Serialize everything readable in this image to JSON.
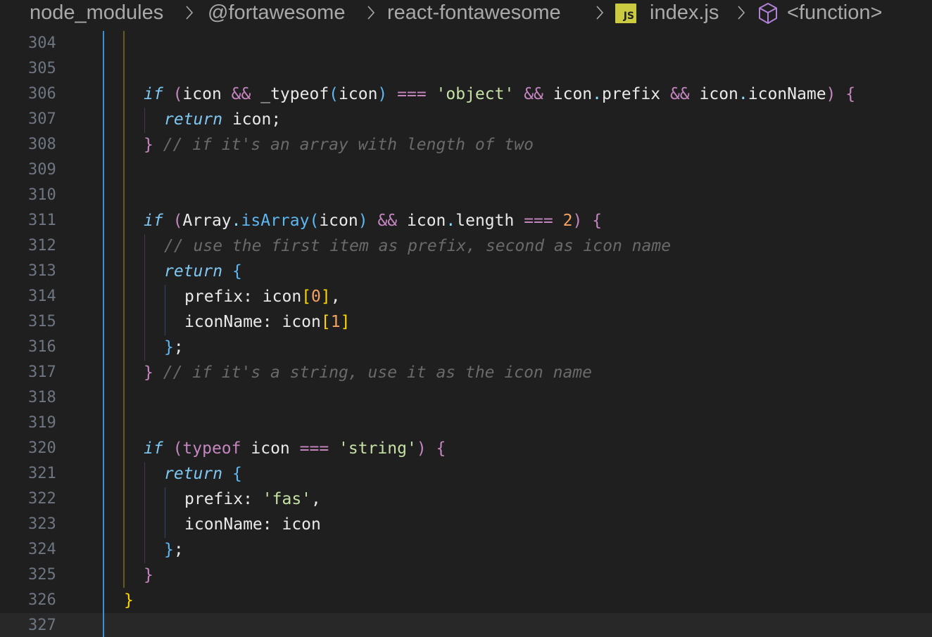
{
  "breadcrumb": {
    "segments": [
      "node_modules",
      "@fortawesome",
      "react-fontawesome",
      "index.js",
      "<function>"
    ],
    "file_badge": "JS",
    "file_icon": "javascript-file-icon",
    "symbol_icon": "cube-icon"
  },
  "colors": {
    "background": "#1f1f1f",
    "current_line": "#282828",
    "line_number": "#6e7681",
    "keyword_italic": "#7ec7f2",
    "keyword_purple": "#c586c0",
    "comment": "#6a6a6a",
    "string": "#c5e1a5",
    "number": "#f4a261",
    "function": "#5eb7f2",
    "js_badge": "#cbcb41"
  },
  "editor": {
    "current_line": "327",
    "lines": [
      {
        "number": "304",
        "tokens": []
      },
      {
        "number": "305",
        "tokens": []
      },
      {
        "number": "306",
        "tokens": [
          {
            "t": "if",
            "c": "kw-i"
          },
          {
            "t": " ",
            "c": "punc"
          },
          {
            "t": "(",
            "c": "pk"
          },
          {
            "t": "icon",
            "c": "var"
          },
          {
            "t": " ",
            "c": "punc"
          },
          {
            "t": "&&",
            "c": "op"
          },
          {
            "t": " ",
            "c": "punc"
          },
          {
            "t": "_typeof",
            "c": "var"
          },
          {
            "t": "(",
            "c": "pb"
          },
          {
            "t": "icon",
            "c": "var"
          },
          {
            "t": ")",
            "c": "pb"
          },
          {
            "t": " ",
            "c": "punc"
          },
          {
            "t": "===",
            "c": "op"
          },
          {
            "t": " ",
            "c": "punc"
          },
          {
            "t": "'object'",
            "c": "str"
          },
          {
            "t": " ",
            "c": "punc"
          },
          {
            "t": "&&",
            "c": "op"
          },
          {
            "t": " ",
            "c": "punc"
          },
          {
            "t": "icon",
            "c": "var"
          },
          {
            "t": ".",
            "c": "dot"
          },
          {
            "t": "prefix",
            "c": "var"
          },
          {
            "t": " ",
            "c": "punc"
          },
          {
            "t": "&&",
            "c": "op"
          },
          {
            "t": " ",
            "c": "punc"
          },
          {
            "t": "icon",
            "c": "var"
          },
          {
            "t": ".",
            "c": "dot"
          },
          {
            "t": "iconName",
            "c": "var"
          },
          {
            "t": ")",
            "c": "pk"
          },
          {
            "t": " ",
            "c": "punc"
          },
          {
            "t": "{",
            "c": "pk"
          }
        ]
      },
      {
        "number": "307",
        "tokens": [
          {
            "t": "return",
            "c": "kw-i"
          },
          {
            "t": " ",
            "c": "punc"
          },
          {
            "t": "icon",
            "c": "var"
          },
          {
            "t": ";",
            "c": "punc"
          }
        ]
      },
      {
        "number": "308",
        "tokens": [
          {
            "t": "}",
            "c": "pk"
          },
          {
            "t": " ",
            "c": "punc"
          },
          {
            "t": "// if it's an array with length of two",
            "c": "cm"
          }
        ]
      },
      {
        "number": "309",
        "tokens": []
      },
      {
        "number": "310",
        "tokens": []
      },
      {
        "number": "311",
        "tokens": [
          {
            "t": "if",
            "c": "kw-i"
          },
          {
            "t": " ",
            "c": "punc"
          },
          {
            "t": "(",
            "c": "pk"
          },
          {
            "t": "Array",
            "c": "var"
          },
          {
            "t": ".",
            "c": "dot"
          },
          {
            "t": "isArray",
            "c": "fn"
          },
          {
            "t": "(",
            "c": "pb"
          },
          {
            "t": "icon",
            "c": "var"
          },
          {
            "t": ")",
            "c": "pb"
          },
          {
            "t": " ",
            "c": "punc"
          },
          {
            "t": "&&",
            "c": "op"
          },
          {
            "t": " ",
            "c": "punc"
          },
          {
            "t": "icon",
            "c": "var"
          },
          {
            "t": ".",
            "c": "dot"
          },
          {
            "t": "length",
            "c": "var"
          },
          {
            "t": " ",
            "c": "punc"
          },
          {
            "t": "===",
            "c": "op"
          },
          {
            "t": " ",
            "c": "punc"
          },
          {
            "t": "2",
            "c": "num"
          },
          {
            "t": ")",
            "c": "pk"
          },
          {
            "t": " ",
            "c": "punc"
          },
          {
            "t": "{",
            "c": "pk"
          }
        ]
      },
      {
        "number": "312",
        "tokens": [
          {
            "t": "// use the first item as prefix, second as icon name",
            "c": "cm"
          }
        ]
      },
      {
        "number": "313",
        "tokens": [
          {
            "t": "return",
            "c": "kw-i"
          },
          {
            "t": " ",
            "c": "punc"
          },
          {
            "t": "{",
            "c": "pb"
          }
        ]
      },
      {
        "number": "314",
        "tokens": [
          {
            "t": "prefix",
            "c": "var"
          },
          {
            "t": ": ",
            "c": "punc"
          },
          {
            "t": "icon",
            "c": "var"
          },
          {
            "t": "[",
            "c": "py"
          },
          {
            "t": "0",
            "c": "num"
          },
          {
            "t": "]",
            "c": "py"
          },
          {
            "t": ",",
            "c": "punc"
          }
        ]
      },
      {
        "number": "315",
        "tokens": [
          {
            "t": "iconName",
            "c": "var"
          },
          {
            "t": ": ",
            "c": "punc"
          },
          {
            "t": "icon",
            "c": "var"
          },
          {
            "t": "[",
            "c": "py"
          },
          {
            "t": "1",
            "c": "num"
          },
          {
            "t": "]",
            "c": "py"
          }
        ]
      },
      {
        "number": "316",
        "tokens": [
          {
            "t": "}",
            "c": "pb"
          },
          {
            "t": ";",
            "c": "punc"
          }
        ]
      },
      {
        "number": "317",
        "tokens": [
          {
            "t": "}",
            "c": "pk"
          },
          {
            "t": " ",
            "c": "punc"
          },
          {
            "t": "// if it's a string, use it as the icon name",
            "c": "cm"
          }
        ]
      },
      {
        "number": "318",
        "tokens": []
      },
      {
        "number": "319",
        "tokens": []
      },
      {
        "number": "320",
        "tokens": [
          {
            "t": "if",
            "c": "kw-i"
          },
          {
            "t": " ",
            "c": "punc"
          },
          {
            "t": "(",
            "c": "pk"
          },
          {
            "t": "typeof",
            "c": "kw-p"
          },
          {
            "t": " ",
            "c": "punc"
          },
          {
            "t": "icon",
            "c": "var"
          },
          {
            "t": " ",
            "c": "punc"
          },
          {
            "t": "===",
            "c": "op"
          },
          {
            "t": " ",
            "c": "punc"
          },
          {
            "t": "'string'",
            "c": "str"
          },
          {
            "t": ")",
            "c": "pk"
          },
          {
            "t": " ",
            "c": "punc"
          },
          {
            "t": "{",
            "c": "pk"
          }
        ]
      },
      {
        "number": "321",
        "tokens": [
          {
            "t": "return",
            "c": "kw-i"
          },
          {
            "t": " ",
            "c": "punc"
          },
          {
            "t": "{",
            "c": "pb"
          }
        ]
      },
      {
        "number": "322",
        "tokens": [
          {
            "t": "prefix",
            "c": "var"
          },
          {
            "t": ": ",
            "c": "punc"
          },
          {
            "t": "'fas'",
            "c": "str"
          },
          {
            "t": ",",
            "c": "punc"
          }
        ]
      },
      {
        "number": "323",
        "tokens": [
          {
            "t": "iconName",
            "c": "var"
          },
          {
            "t": ": ",
            "c": "punc"
          },
          {
            "t": "icon",
            "c": "var"
          }
        ]
      },
      {
        "number": "324",
        "tokens": [
          {
            "t": "}",
            "c": "pb"
          },
          {
            "t": ";",
            "c": "punc"
          }
        ]
      },
      {
        "number": "325",
        "tokens": [
          {
            "t": "}",
            "c": "pk"
          }
        ]
      },
      {
        "number": "326",
        "tokens": [
          {
            "t": "}",
            "c": "py"
          }
        ]
      },
      {
        "number": "327",
        "tokens": []
      }
    ]
  }
}
